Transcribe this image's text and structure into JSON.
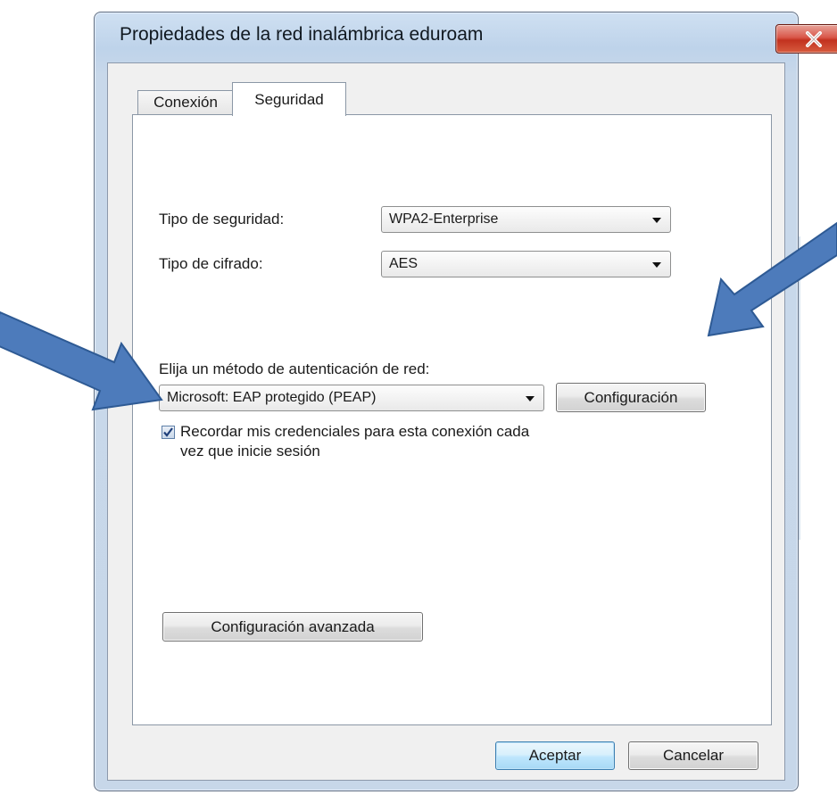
{
  "window": {
    "title": "Propiedades de la red inalámbrica eduroam",
    "close_icon": "close-icon"
  },
  "tabs": [
    {
      "label": "Conexión",
      "selected": false
    },
    {
      "label": "Seguridad",
      "selected": true
    }
  ],
  "security": {
    "security_type_label": "Tipo de seguridad:",
    "security_type_value": "WPA2-Enterprise",
    "encryption_type_label": "Tipo de cifrado:",
    "encryption_type_value": "AES",
    "auth_method_label": "Elija un método de autenticación de red:",
    "auth_method_value": "Microsoft: EAP protegido (PEAP)",
    "settings_button": "Configuración",
    "remember_line1": "Recordar mis credenciales para esta conexión cada",
    "remember_line2": "vez que inicie sesión",
    "remember_checked": true,
    "advanced_button": "Configuración avanzada"
  },
  "footer": {
    "ok_button": "Aceptar",
    "cancel_button": "Cancelar"
  },
  "annotations": {
    "arrow_color": "#4a7ab8"
  }
}
